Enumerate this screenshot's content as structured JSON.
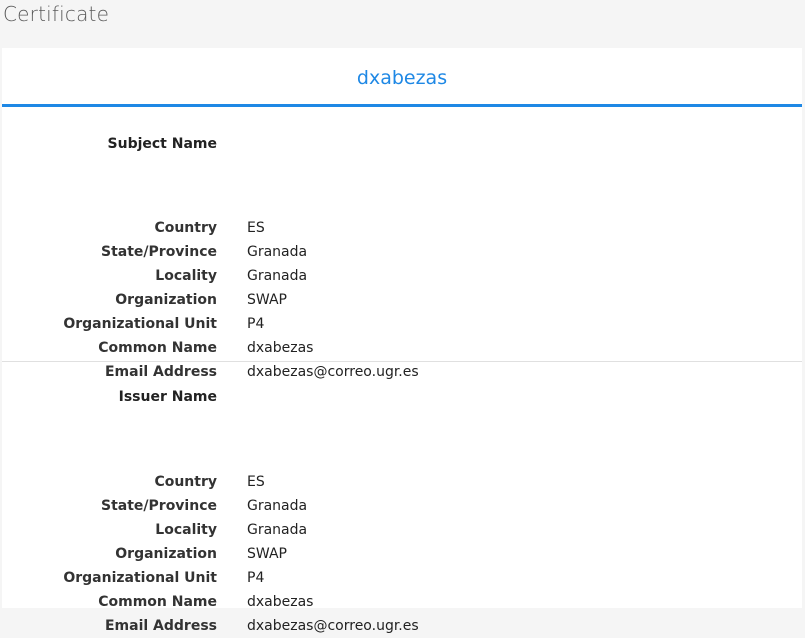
{
  "page_title": "Certificate",
  "tab": {
    "title": "dxabezas"
  },
  "subject": {
    "heading": "Subject Name",
    "fields": [
      {
        "label": "Country",
        "value": "ES"
      },
      {
        "label": "State/Province",
        "value": "Granada"
      },
      {
        "label": "Locality",
        "value": "Granada"
      },
      {
        "label": "Organization",
        "value": "SWAP"
      },
      {
        "label": "Organizational Unit",
        "value": "P4"
      },
      {
        "label": "Common Name",
        "value": "dxabezas"
      },
      {
        "label": "Email Address",
        "value": "dxabezas@correo.ugr.es"
      }
    ]
  },
  "issuer": {
    "heading": "Issuer Name",
    "fields": [
      {
        "label": "Country",
        "value": "ES"
      },
      {
        "label": "State/Province",
        "value": "Granada"
      },
      {
        "label": "Locality",
        "value": "Granada"
      },
      {
        "label": "Organization",
        "value": "SWAP"
      },
      {
        "label": "Organizational Unit",
        "value": "P4"
      },
      {
        "label": "Common Name",
        "value": "dxabezas"
      },
      {
        "label": "Email Address",
        "value": "dxabezas@correo.ugr.es"
      }
    ]
  },
  "colors": {
    "accent": "#1e88e5",
    "background": "#f5f5f5",
    "card": "#ffffff"
  }
}
